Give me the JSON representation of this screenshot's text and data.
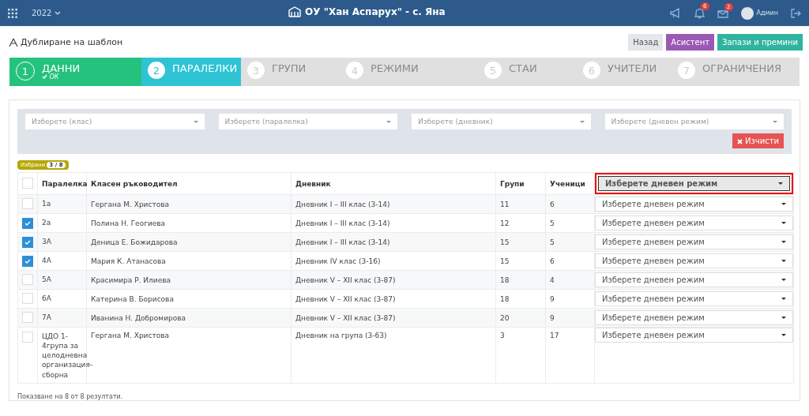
{
  "topbar": {
    "year": "2022",
    "school": "ОУ \"Хан Аспарух\" - с. Яна",
    "notifications": "6",
    "messages": "2",
    "user": "Админ"
  },
  "page_title": "Дублиране на шаблон",
  "actions": [
    {
      "label": "Назад",
      "kind": "back"
    },
    {
      "label": "Асистент",
      "kind": "assistant"
    },
    {
      "label": "Запази и премини",
      "kind": "save"
    }
  ],
  "steps": [
    {
      "number": "1",
      "label": "ДАННИ",
      "kind": "done",
      "note": "ОК"
    },
    {
      "number": "2",
      "label": "ПАРАЛЕЛКИ",
      "kind": "active"
    },
    {
      "number": "3",
      "label": "ГРУПИ",
      "kind": "pending"
    },
    {
      "number": "4",
      "label": "РЕЖИМИ",
      "kind": "pending"
    },
    {
      "number": "5",
      "label": "СТАИ",
      "kind": "pending"
    },
    {
      "number": "6",
      "label": "УЧИТЕЛИ",
      "kind": "pending"
    },
    {
      "number": "7",
      "label": "ОГРАНИЧЕНИЯ",
      "kind": "pending"
    }
  ],
  "filters": [
    {
      "placeholder": "Изберете (клас)"
    },
    {
      "placeholder": "Изберете (паралелка)"
    },
    {
      "placeholder": "Изберете (дневник)"
    },
    {
      "placeholder": "Изберете (дневен режим)"
    }
  ],
  "clear_button": "Изчисти",
  "selected_badge": {
    "label": "Избрани",
    "count": "3 / 8"
  },
  "table": {
    "columns": [
      "Паралелка",
      "Класен ръководител",
      "Дневник",
      "Групи",
      "Ученици"
    ],
    "all_checked": false,
    "header_select": {
      "value": "Изберете дневен режим",
      "highlighted": true
    },
    "rows": [
      {
        "checked": false,
        "class": "1а",
        "teacher": "Гергана М. Христова",
        "journal": "Дневник I – III клас (3-14)",
        "groups": "11",
        "students": "6",
        "mode": "Изберете дневен режим"
      },
      {
        "checked": true,
        "class": "2а",
        "teacher": "Полина Н. Геогиева",
        "journal": "Дневник I – III клас (3-14)",
        "groups": "12",
        "students": "5",
        "mode": "Изберете дневен режим"
      },
      {
        "checked": true,
        "class": "3А",
        "teacher": "Деница Е. Божидарова",
        "journal": "Дневник I – III клас (3-14)",
        "groups": "15",
        "students": "5",
        "mode": "Изберете дневен режим"
      },
      {
        "checked": true,
        "class": "4А",
        "teacher": "Мария К. Атанасова",
        "journal": "Дневник IV клас (3-16)",
        "groups": "15",
        "students": "6",
        "mode": "Изберете дневен режим"
      },
      {
        "checked": false,
        "class": "5А",
        "teacher": "Красимира Р. Илиева",
        "journal": "Дневник V – XII клас (3-87)",
        "groups": "18",
        "students": "4",
        "mode": "Изберете дневен режим"
      },
      {
        "checked": false,
        "class": "6А",
        "teacher": "Катерина В. Борисова",
        "journal": "Дневник V – XII клас (3-87)",
        "groups": "18",
        "students": "9",
        "mode": "Изберете дневен режим"
      },
      {
        "checked": false,
        "class": "7А",
        "teacher": "Иванина Н. Добромирова",
        "journal": "Дневник V – XII клас (3-87)",
        "groups": "20",
        "students": "9",
        "mode": "Изберете дневен режим"
      },
      {
        "checked": false,
        "class": "ЦДО 1-4група за целодневна организация-сборна",
        "teacher": "Гергана М. Христова",
        "journal": "Дневник на група (3-63)",
        "groups": "3",
        "students": "17",
        "mode": "Изберете дневен режим"
      }
    ]
  },
  "footer": "Показване на 8 от 8 резултати."
}
